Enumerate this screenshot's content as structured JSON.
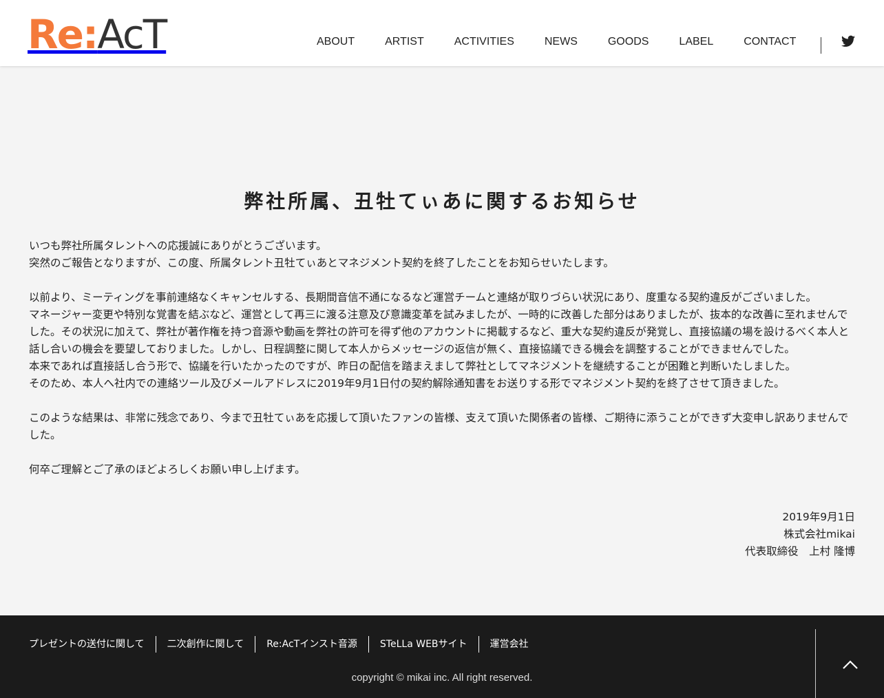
{
  "header": {
    "logo": {
      "part1": "Re:",
      "part2": "AcT",
      "accent_color": "#f47a3a",
      "dark_color": "#333333"
    },
    "nav": [
      "ABOUT",
      "ARTIST",
      "ACTIVITIES",
      "NEWS",
      "GOODS",
      "LABEL",
      "CONTACT"
    ],
    "social_icon": "twitter-icon"
  },
  "main": {
    "title": "弊社所属、丑牡てぃあに関するお知らせ",
    "paragraphs": [
      "いつも弊社所属タレントへの応援誠にありがとうございます。",
      "突然のご報告となりますが、この度、所属タレント丑牡てぃあとマネジメント契約を終了したことをお知らせいたします。",
      "",
      "以前より、ミーティングを事前連絡なくキャンセルする、長期間音信不通になるなど運営チームと連絡が取りづらい状況にあり、度重なる契約違反がございました。",
      "マネージャー変更や特別な覚書を結ぶなど、運営として再三に渡る注意及び意識変革を試みましたが、一時的に改善した部分はありましたが、抜本的な改善に至れませんでした。その状況に加えて、弊社が著作権を持つ音源や動画を弊社の許可を得ず他のアカウントに掲載するなど、重大な契約違反が発覚し、直接協議の場を設けるべく本人と話し合いの機会を要望しておりました。しかし、日程調整に関して本人からメッセージの返信が無く、直接協議できる機会を調整することができませんでした。",
      "本来であれば直接話し合う形で、協議を行いたかったのですが、昨日の配信を踏まえまして弊社としてマネジメントを継続することが困難と判断いたしました。",
      "そのため、本人へ社内での連絡ツール及びメールアドレスに2019年9月1日付の契約解除通知書をお送りする形でマネジメント契約を終了させて頂きました。",
      "",
      "このような結果は、非常に残念であり、今まで丑牡てぃあを応援して頂いたファンの皆様、支えて頂いた関係者の皆様、ご期待に添うことができず大変申し訳ありませんでした。",
      "",
      "何卒ご理解とご了承のほどよろしくお願い申し上げます。"
    ],
    "signature": {
      "date": "2019年9月1日",
      "company": "株式会社mikai",
      "representative": "代表取締役　上村 隆博"
    }
  },
  "footer": {
    "links": [
      "プレゼントの送付に関して",
      "二次創作に関して",
      "Re:AcTインスト音源",
      "STeLLa WEBサイト",
      "運営会社"
    ],
    "copyright": "copyright © mikai inc. All right reserved.",
    "back_to_top_icon": "chevron-up-icon",
    "background": "#1b1b1b"
  }
}
